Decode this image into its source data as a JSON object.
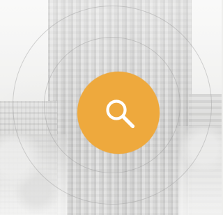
{
  "scene": {
    "accent_color": "#eea93d",
    "background_color": "#e9e9e7",
    "ring_color": "#9b9b9b"
  },
  "search_button": {
    "icon": "search-icon"
  }
}
